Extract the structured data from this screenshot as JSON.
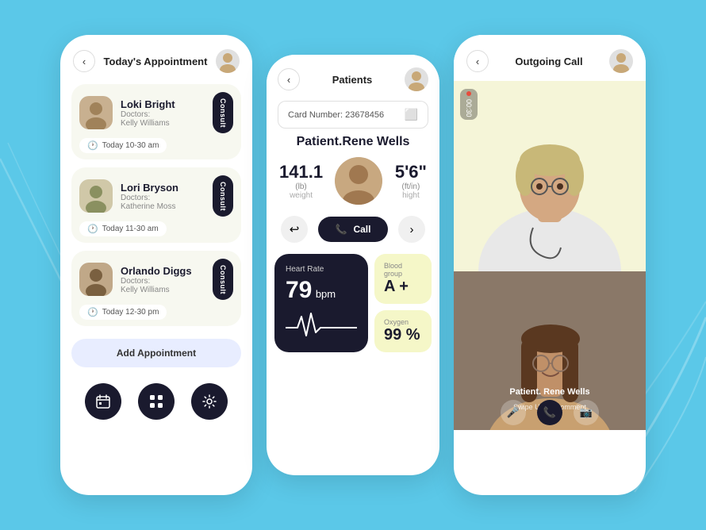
{
  "background": "#5bc8e8",
  "left_phone": {
    "header": {
      "title": "Today's Appointment",
      "back_label": "‹",
      "avatar_color": "#c8b090"
    },
    "appointments": [
      {
        "name": "Loki Bright",
        "doctor_label": "Doctors:",
        "doctor": "Kelly Williams",
        "time": "Today 10-30 am",
        "consult": "Consult",
        "avatar_color": "#b09070"
      },
      {
        "name": "Lori Bryson",
        "doctor_label": "Doctors:",
        "doctor": "Katherine Moss",
        "time": "Today 11-30 am",
        "consult": "Consult",
        "avatar_color": "#90a070"
      },
      {
        "name": "Orlando Diggs",
        "doctor_label": "Doctors:",
        "doctor": "Kelly Williams",
        "time": "Today 12-30 pm",
        "consult": "Consult",
        "avatar_color": "#a08060"
      }
    ],
    "add_button": "Add Appointment",
    "nav_icons": [
      "calendar",
      "grid",
      "settings"
    ]
  },
  "center_phone": {
    "header": {
      "back_label": "‹",
      "title": "Patients",
      "avatar_color": "#c8b090"
    },
    "card_number_label": "Card Number: 23678456",
    "patient_name": "Patient.Rene Wells",
    "weight": {
      "value": "141.1",
      "unit": "(lb)",
      "label": "weight"
    },
    "height": {
      "value": "5'6\"",
      "unit": "(ft/in)",
      "label": "hight"
    },
    "call_label": "Call",
    "health": {
      "heart_rate_label": "Heart Rate",
      "heart_rate_value": "79",
      "heart_rate_unit": "bpm",
      "blood_group_label": "Blood group",
      "blood_group_value": "A +",
      "oxygen_label": "Oxygen",
      "oxygen_value": "99 %"
    }
  },
  "right_phone": {
    "header": {
      "title": "Outgoing Call",
      "back_label": "‹",
      "avatar_color": "#c8b090"
    },
    "timer": "00:30",
    "doctor_bg": "#f0f0d0",
    "patient_name": "Patient. Rene Wells",
    "swipe_label": "Swipe Up To Comment",
    "controls": [
      "mic",
      "phone",
      "camera"
    ]
  }
}
